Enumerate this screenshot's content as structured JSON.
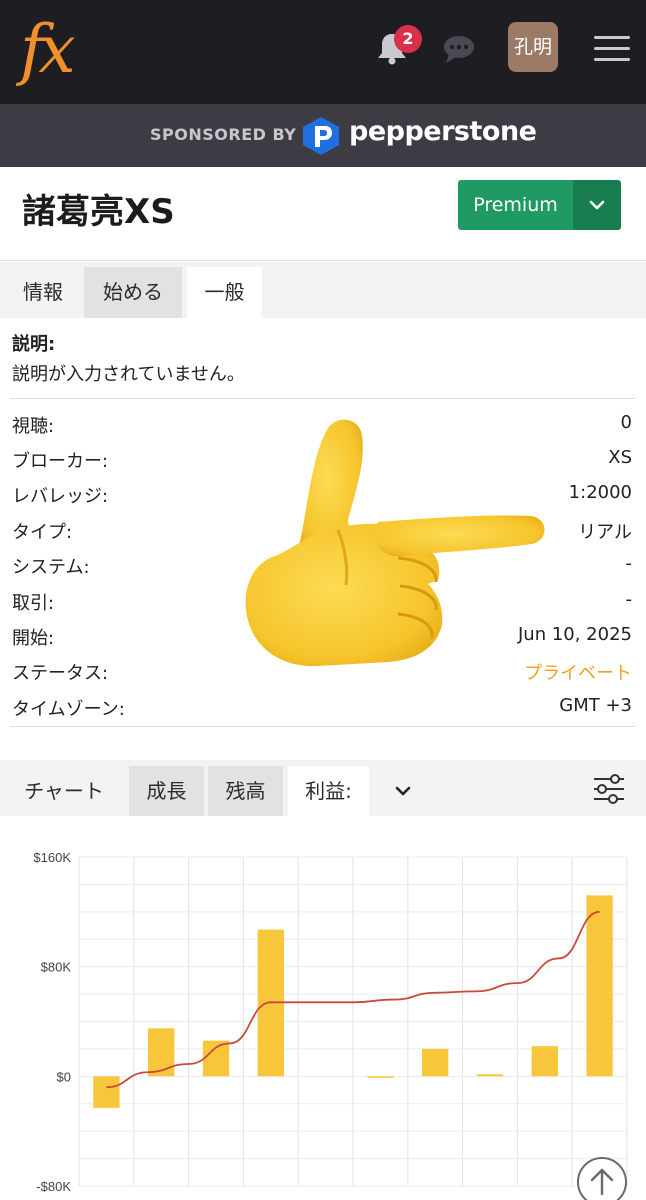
{
  "header": {
    "logo_text": "fx",
    "notification_count": "2",
    "avatar_text": "孔明",
    "icons": [
      "bell-icon",
      "chat-icon",
      "menu-icon"
    ]
  },
  "sponsor": {
    "label": "SPONSORED BY",
    "brand": "pepperstone"
  },
  "account": {
    "title": "諸葛亮XS",
    "premium_label": "Premium"
  },
  "tabs": [
    {
      "label": "情報"
    },
    {
      "label": "始める"
    },
    {
      "label": "一般"
    }
  ],
  "description": {
    "label": "説明:",
    "text": "説明が入力されていません。"
  },
  "info_rows": [
    {
      "key": "視聴:",
      "value": "0"
    },
    {
      "key": "ブローカー:",
      "value": "XS"
    },
    {
      "key": "レバレッジ:",
      "value": "1:2000"
    },
    {
      "key": "タイプ:",
      "value": "リアル"
    },
    {
      "key": "システム:",
      "value": "-"
    },
    {
      "key": "取引:",
      "value": "-"
    },
    {
      "key": "開始:",
      "value": "Jun 10, 2025"
    },
    {
      "key": "ステータス:",
      "value": "プライベート"
    },
    {
      "key": "タイムゾーン:",
      "value": "GMT +3"
    }
  ],
  "chart_tabs": {
    "title": "チャート",
    "items": [
      "成長",
      "残高",
      "利益:"
    ]
  },
  "colors": {
    "accent_green": "#1f9a63",
    "status_orange": "#f0a21e",
    "bar_yellow": "#f8c63a",
    "line_red": "#c94a3a"
  },
  "chart_data": {
    "type": "bar",
    "ylim": [
      -80000,
      160000
    ],
    "y_ticks": [
      "$160K",
      "$80K",
      "$0",
      "-$80K"
    ],
    "y_tick_values": [
      160000,
      80000,
      0,
      -80000
    ],
    "bar_values": [
      -23000,
      35000,
      26000,
      107000,
      0,
      -600,
      20000,
      1500,
      22000,
      132000
    ],
    "line_values": [
      -8000,
      3000,
      9000,
      24000,
      54000,
      54000,
      54000,
      56000,
      61000,
      62000,
      68000,
      86000,
      120000
    ],
    "grid": true
  }
}
